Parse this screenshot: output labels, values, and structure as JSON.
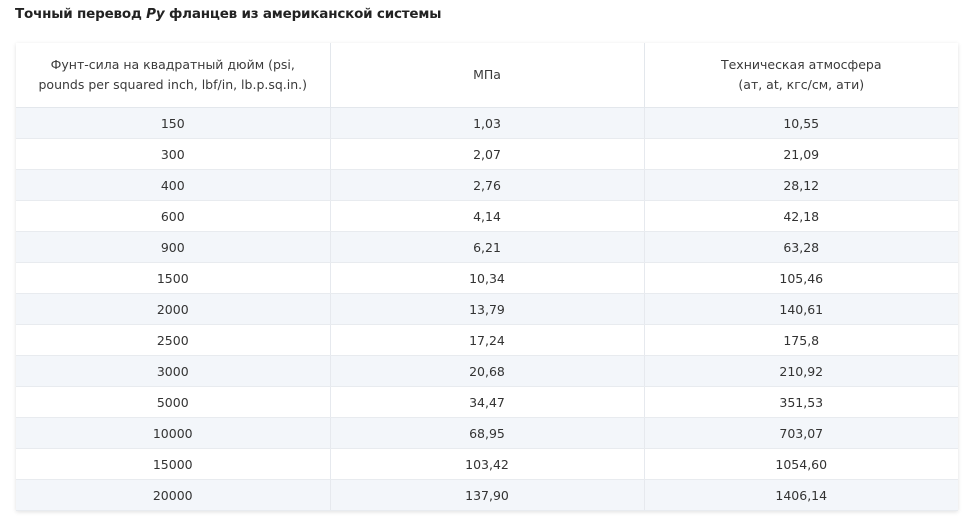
{
  "title": {
    "prefix": "Точный перевод ",
    "emphasis": "Ру",
    "suffix": " фланцев из американской системы"
  },
  "table": {
    "headers": [
      [
        "Фунт-сила на квадратный дюйм (psi,",
        "pounds per squared inch, lbf/in, lb.p.sq.in.)"
      ],
      [
        "МПа"
      ],
      [
        "Техническая атмосфера",
        "(ат, at, кгс/см, ати)"
      ]
    ],
    "rows": [
      [
        "150",
        "1,03",
        "10,55"
      ],
      [
        "300",
        "2,07",
        "21,09"
      ],
      [
        "400",
        "2,76",
        "28,12"
      ],
      [
        "600",
        "4,14",
        "42,18"
      ],
      [
        "900",
        "6,21",
        "63,28"
      ],
      [
        "1500",
        "10,34",
        "105,46"
      ],
      [
        "2000",
        "13,79",
        "140,61"
      ],
      [
        "2500",
        "17,24",
        "175,8"
      ],
      [
        "3000",
        "20,68",
        "210,92"
      ],
      [
        "5000",
        "34,47",
        "351,53"
      ],
      [
        "10000",
        "68,95",
        "703,07"
      ],
      [
        "15000",
        "103,42",
        "1054,60"
      ],
      [
        "20000",
        "137,90",
        "1406,14"
      ]
    ]
  }
}
